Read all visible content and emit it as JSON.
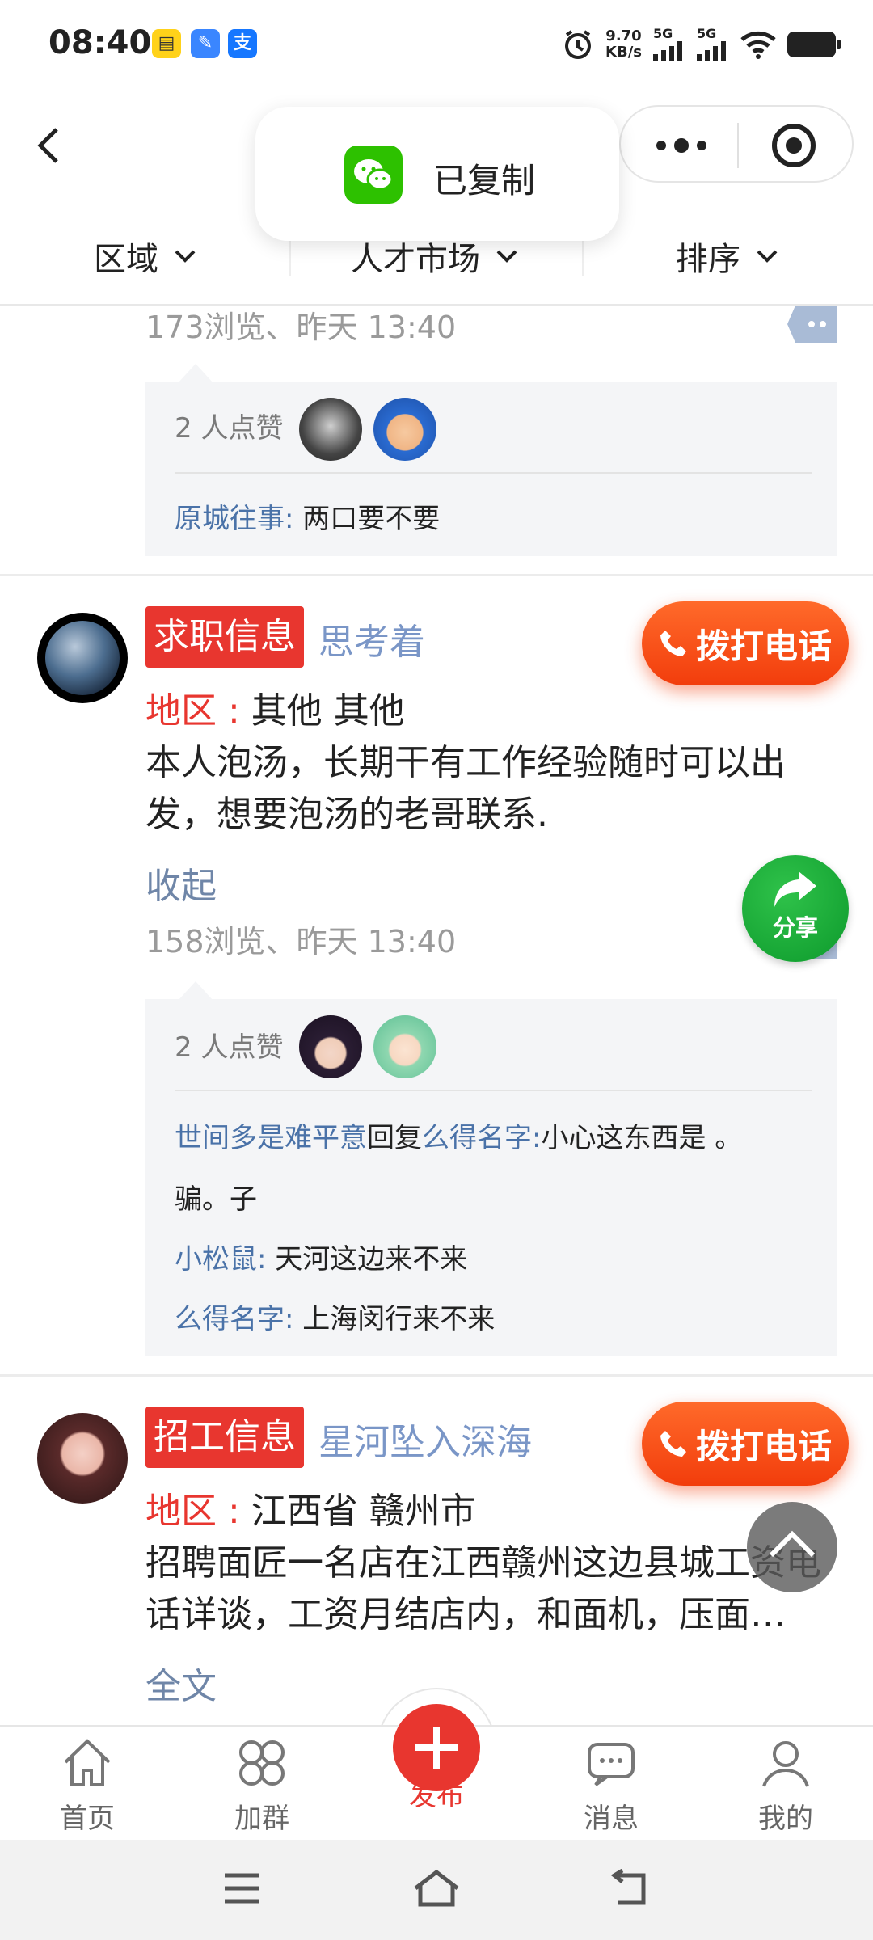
{
  "status_bar": {
    "time": "08:40",
    "net_speed_value": "9.70",
    "net_speed_unit": "KB/s",
    "sim1": "5G",
    "sim2": "5G",
    "app_icon_1": "ticket",
    "app_icon_2": "feather",
    "app_icon_3": "支"
  },
  "toast": {
    "text": "已复制",
    "icon": "wechat-icon"
  },
  "filters": {
    "region": "区域",
    "category": "人才市场",
    "sort": "排序"
  },
  "post_prev": {
    "meta": "173浏览、昨天 13:40",
    "likes_label": "2 人点赞",
    "comments": [
      {
        "name": "原城往事:",
        "text": " 两口要不要"
      }
    ]
  },
  "post1": {
    "tag": "求职信息",
    "username": "思考着",
    "call_label": "拨打电话",
    "region_label": "地区 :",
    "region_value": " 其他 其他",
    "content_line1": "本人泡汤，长期干有工作经验随时可以出",
    "content_line2": "发，想要泡汤的老哥联系.",
    "fold_label": "收起",
    "share_label": "分享",
    "meta": "158浏览、昨天 13:40",
    "likes_label": "2 人点赞",
    "comments": [
      {
        "name": "世间多是难平意",
        "reply_word": "回复",
        "reply_to": "么得名字:",
        "text": "小心这东西是 。"
      },
      {
        "text": "骗。子"
      },
      {
        "name": "小松鼠:",
        "text": " 天河这边来不来"
      },
      {
        "name": "么得名字:",
        "text": " 上海闵行来不来"
      }
    ]
  },
  "post2": {
    "tag": "招工信息",
    "username": "星河坠入深海",
    "call_label": "拨打电话",
    "region_label": "地区 :",
    "region_value": " 江西省 赣州市",
    "content_line1": "招聘面匠一名店在江西赣州这边县城工资电",
    "content_line2": "话详谈，工资月结店内，和面机，压面…",
    "fold_label": "全文"
  },
  "tabbar": {
    "home": "首页",
    "groups": "加群",
    "publish": "发布",
    "messages": "消息",
    "mine": "我的"
  },
  "colors": {
    "accent_red": "#e8362f",
    "call_orange": "#f23d0c",
    "share_green": "#0d9a2c",
    "link_blue": "#4a72a8"
  }
}
